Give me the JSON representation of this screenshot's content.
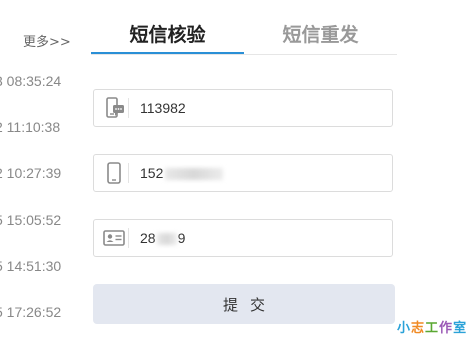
{
  "left": {
    "more_label": "更多>>",
    "times": [
      "3 08:35:24",
      "2 11:10:38",
      "2 10:27:39",
      "5 15:05:52",
      "5 14:51:30",
      "5 17:26:52"
    ]
  },
  "tabs": [
    {
      "label": "短信核验",
      "active": true
    },
    {
      "label": "短信重发",
      "active": false
    }
  ],
  "form": {
    "code_value": "113982",
    "phone_prefix": "152",
    "id_prefix": "28",
    "id_suffix": "9",
    "submit_label": "提交"
  },
  "watermark": {
    "chars": [
      "小",
      "志",
      "工",
      "作",
      "室"
    ]
  },
  "icons": {
    "code_field": "sms-phone-icon",
    "phone_field": "mobile-phone-icon",
    "id_field": "id-card-icon"
  },
  "colors": {
    "active_tab_underline": "#2a8fd6",
    "active_tab_text": "#222222",
    "inactive_tab_text": "#999999",
    "submit_bg": "#e3e7f0"
  }
}
